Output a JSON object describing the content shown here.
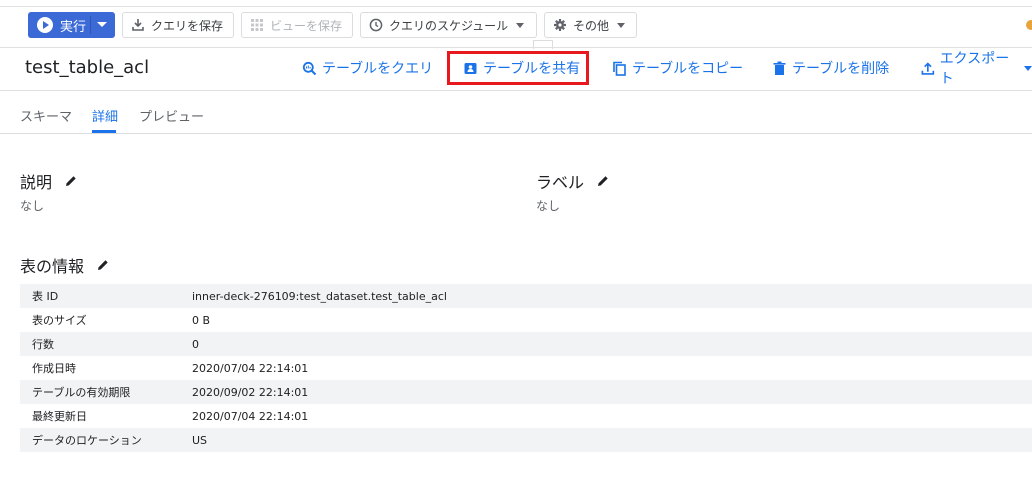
{
  "toolbar": {
    "run_label": "実行",
    "save_query_label": "クエリを保存",
    "save_view_label": "ビューを保存",
    "schedule_label": "クエリのスケジュール",
    "more_label": "その他"
  },
  "header": {
    "table_name": "test_table_acl",
    "actions": {
      "query": "テーブルをクエリ",
      "share": "テーブルを共有",
      "copy": "テーブルをコピー",
      "delete": "テーブルを削除",
      "export": "エクスポート"
    }
  },
  "tabs": [
    "スキーマ",
    "詳細",
    "プレビュー"
  ],
  "active_tab": "詳細",
  "description": {
    "title": "説明",
    "value": "なし"
  },
  "labels": {
    "title": "ラベル",
    "value": "なし"
  },
  "table_info": {
    "title": "表の情報",
    "rows": [
      {
        "key": "表 ID",
        "value": "inner-deck-276109:test_dataset.test_table_acl"
      },
      {
        "key": "表のサイズ",
        "value": "0 B"
      },
      {
        "key": "行数",
        "value": "0"
      },
      {
        "key": "作成日時",
        "value": "2020/07/04 22:14:01"
      },
      {
        "key": "テーブルの有効期限",
        "value": "2020/09/02 22:14:01"
      },
      {
        "key": "最終更新日",
        "value": "2020/07/04 22:14:01"
      },
      {
        "key": "データのロケーション",
        "value": "US"
      }
    ]
  },
  "colors": {
    "accent": "#1a73e8",
    "run_button": "#3b69d6",
    "highlight": "#e8191d"
  }
}
